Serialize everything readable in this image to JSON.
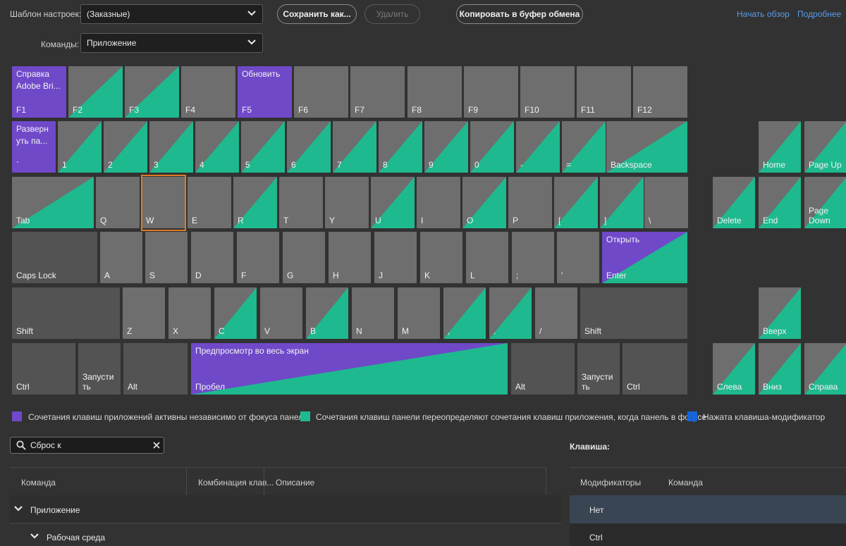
{
  "header": {
    "preset_label": "Шаблон настроек:",
    "preset_value": "(Заказные)",
    "save_as": "Сохранить как...",
    "delete": "Удалить",
    "copy": "Копировать в буфер обмена",
    "tour_link": "Начать обзор",
    "more_link": "Подробнее",
    "commands_label": "Команды:",
    "commands_value": "Приложение"
  },
  "keys": {
    "f1": {
      "label": "F1",
      "cmd": "Справка\nAdobe Bri..."
    },
    "f2": "F2",
    "f3": "F3",
    "f4": "F4",
    "f5": {
      "label": "F5",
      "cmd": "Обновить"
    },
    "f6": "F6",
    "f7": "F7",
    "f8": "F8",
    "f9": "F9",
    "f10": "F10",
    "f11": "F11",
    "f12": "F12",
    "grave": {
      "label": "`",
      "cmd": "Разверн\nуть па..."
    },
    "n1": "1",
    "n2": "2",
    "n3": "3",
    "n4": "4",
    "n5": "5",
    "n6": "6",
    "n7": "7",
    "n8": "8",
    "n9": "9",
    "n0": "0",
    "minus": "-",
    "equal": "=",
    "backspace": "Backspace",
    "home": "Home",
    "pageup": "Page Up",
    "tab": "Tab",
    "q": "Q",
    "w": "W",
    "e": "E",
    "r": "R",
    "t": "T",
    "y": "Y",
    "u": "U",
    "i": "I",
    "o": "O",
    "p": "P",
    "lbracket": "[",
    "rbracket": "]",
    "backslash": "\\",
    "delete": "Delete",
    "end": "End",
    "pagedown": "Page\nDown",
    "capslock": "Caps Lock",
    "a": "A",
    "s": "S",
    "d": "D",
    "f": "F",
    "g": "G",
    "h": "H",
    "j": "J",
    "k": "K",
    "l": "L",
    "semicolon": ";",
    "quote": "'",
    "enter": {
      "label": "Enter",
      "cmd": "Открыть"
    },
    "lshift": "Shift",
    "z": "Z",
    "x": "X",
    "c": "C",
    "v": "V",
    "b": "B",
    "n": "N",
    "m": "M",
    "comma": ",",
    "period": ".",
    "slash": "/",
    "rshift": "Shift",
    "up": "Вверх",
    "lctrl": "Ctrl",
    "lcmd": "Запусти\nть",
    "lalt": "Alt",
    "space": {
      "label": "Пробел",
      "cmd": "Предпросмотр во весь экран"
    },
    "ralt": "Alt",
    "rcmd": "Запусти\nть",
    "rctrl": "Ctrl",
    "left": "Слева",
    "down": "Вниз",
    "right": "Справа"
  },
  "legend": {
    "app": "Сочетания клавиш приложений активны независимо от фокуса панели",
    "panel": "Сочетания клавиш панели переопределяют сочетания клавиш приложения, когда панель в фокусе",
    "modifier": "Нажата клавиша-модификатор"
  },
  "colors": {
    "app": "#7049c9",
    "panel": "#1fb98f",
    "modifier": "#1565d8",
    "selected": "#e07a24"
  },
  "search": {
    "value": "Сброс к"
  },
  "table": {
    "col_command": "Команда",
    "col_shortcut": "Комбинация клав...",
    "col_description": "Описание",
    "rows": [
      {
        "label": "Приложение"
      },
      {
        "label": "Рабочая среда"
      }
    ]
  },
  "key_panel": {
    "title": "Клавиша:",
    "col_modifiers": "Модификаторы",
    "col_command": "Команда",
    "rows": [
      "Нет",
      "Ctrl"
    ]
  }
}
